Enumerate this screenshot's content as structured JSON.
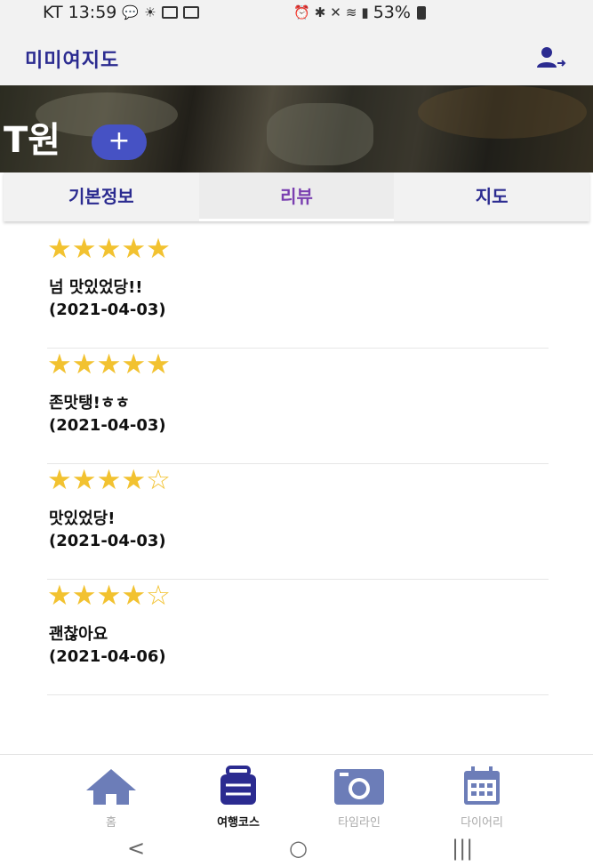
{
  "status_bar": {
    "carrier_time": "KT 13:59",
    "battery": "53%"
  },
  "app_bar": {
    "title": "미미여지도"
  },
  "hero": {
    "place_name": "T원",
    "add_label": "+"
  },
  "tabs": [
    {
      "label": "기본정보"
    },
    {
      "label": "리뷰"
    },
    {
      "label": "지도"
    }
  ],
  "active_tab": "리뷰",
  "reviews": [
    {
      "rating": 5,
      "stars": "★★★★★",
      "text": "넘 맛있었당!!",
      "date": "(2021-04-03)"
    },
    {
      "rating": 5,
      "stars": "★★★★★",
      "text": "존맛탱!ㅎㅎ",
      "date": "(2021-04-03)"
    },
    {
      "rating": 4,
      "stars": "★★★★☆",
      "text": "맛있었당!",
      "date": "(2021-04-03)"
    },
    {
      "rating": 4,
      "stars": "★★★★☆",
      "text": "괜찮아요",
      "date": "(2021-04-06)"
    }
  ],
  "bottom_nav": [
    {
      "label": "홈",
      "icon": "home-icon",
      "active": false
    },
    {
      "label": "여행코스",
      "icon": "luggage-icon",
      "active": true
    },
    {
      "label": "타임라인",
      "icon": "camera-icon",
      "active": false
    },
    {
      "label": "다이어리",
      "icon": "calendar-icon",
      "active": false
    }
  ],
  "system_nav": {
    "back": "<",
    "home": "○",
    "recents": "|||"
  },
  "colors": {
    "primary": "#2b2b90",
    "accent": "#4652c4",
    "star": "#f2c230",
    "tab_active": "#7a3fb0"
  }
}
